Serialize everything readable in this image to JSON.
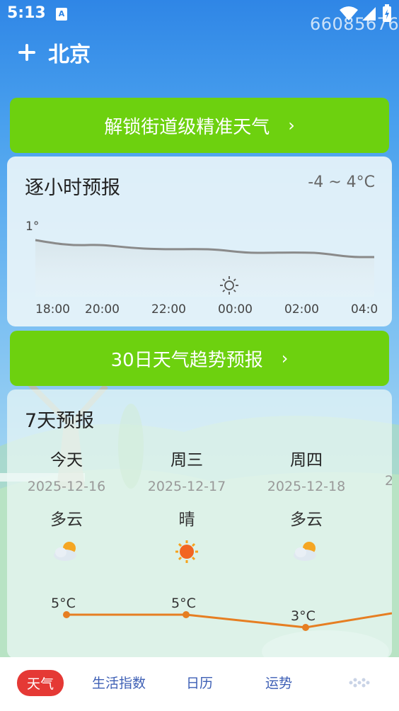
{
  "status": {
    "time": "5:13",
    "a_badge": "A",
    "watermark": "66085676"
  },
  "header": {
    "city": "北京"
  },
  "banners": {
    "street_weather": "解锁街道级精准天气",
    "trend_30": "30日天气趋势预报"
  },
  "hourly": {
    "title": "逐小时预报",
    "temp_range": "-4 ~ 4°C",
    "top_label": "1°",
    "times": [
      "18:00",
      "20:00",
      "22:00",
      "00:00",
      "02:00",
      "04:0"
    ],
    "icon": "sun-outline-icon"
  },
  "weekly": {
    "title": "7天预报",
    "days": [
      {
        "name": "今天",
        "date": "2025-12-16",
        "cond": "多云",
        "icon": "cloudy-icon",
        "temp": "5°C"
      },
      {
        "name": "周三",
        "date": "2025-12-17",
        "cond": "晴",
        "icon": "sunny-icon",
        "temp": "5°C"
      },
      {
        "name": "周四",
        "date": "2025-12-18",
        "cond": "多云",
        "icon": "cloudy-icon",
        "temp": "3°C"
      }
    ],
    "partial_date": "2"
  },
  "nav": {
    "items": [
      "天气",
      "生活指数",
      "日历",
      "运势"
    ]
  },
  "colors": {
    "accent_green": "#6dd10f",
    "nav_active": "#e53935",
    "line_orange": "#e67e22"
  }
}
